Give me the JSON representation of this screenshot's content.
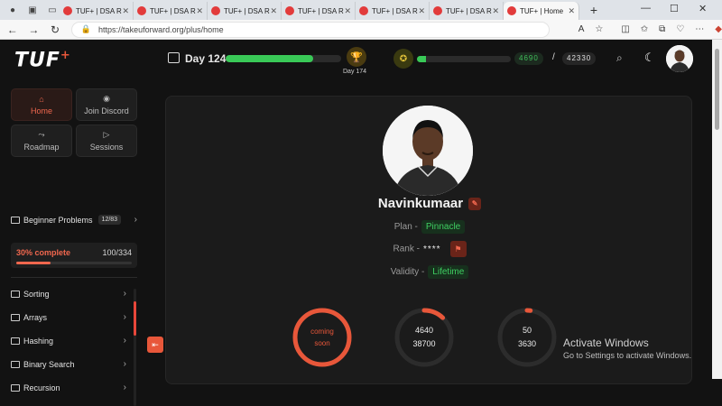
{
  "browser": {
    "tabs": [
      {
        "title": "TUF+ | DSA R"
      },
      {
        "title": "TUF+ | DSA R"
      },
      {
        "title": "TUF+ | DSA R"
      },
      {
        "title": "TUF+ | DSA R"
      },
      {
        "title": "TUF+ | DSA R"
      },
      {
        "title": "TUF+ | DSA R"
      },
      {
        "title": "TUF+ | Home"
      }
    ],
    "url": "https://takeuforward.org/plus/home",
    "window_controls": {
      "minimize": "—",
      "maximize": "☐",
      "close": "✕"
    }
  },
  "topnav": {
    "logo": "TUF",
    "logo_plus": "+",
    "day_label": "Day 124",
    "day_progress_pct": 76,
    "trophy_label": "Day 174",
    "points_progress_pct": 10,
    "points_current": "4690",
    "points_separator": "/",
    "points_total": "42330"
  },
  "sidebar": {
    "buttons": [
      {
        "label": "Home",
        "icon": "home-icon"
      },
      {
        "label": "Join Discord",
        "icon": "discord-icon"
      },
      {
        "label": "Roadmap",
        "icon": "roadmap-icon"
      },
      {
        "label": "Sessions",
        "icon": "video-icon"
      }
    ],
    "beginner": {
      "label": "Beginner Problems",
      "badge": "12/83"
    },
    "progress": {
      "label": "30% complete",
      "value": "100/334",
      "pct": 30
    },
    "topics": [
      {
        "label": "Sorting"
      },
      {
        "label": "Arrays"
      },
      {
        "label": "Hashing"
      },
      {
        "label": "Binary Search"
      },
      {
        "label": "Recursion"
      }
    ]
  },
  "profile": {
    "name": "Navinkumaar",
    "plan_label": "Plan -",
    "plan_value": "Pinnacle",
    "rank_label": "Rank -",
    "rank_value": "****",
    "validity_label": "Validity -",
    "validity_value": "Lifetime"
  },
  "stats": [
    {
      "line1": "coming",
      "line2": "soon",
      "fraction": 1.0,
      "color": "#e8573a"
    },
    {
      "line1": "4640",
      "line2": "38700",
      "fraction": 0.12,
      "color": "#e8573a"
    },
    {
      "line1": "50",
      "line2": "3630",
      "fraction": 0.02,
      "color": "#e8573a"
    }
  ],
  "watermark": {
    "line1": "Activate Windows",
    "line2": "Go to Settings to activate Windows."
  }
}
